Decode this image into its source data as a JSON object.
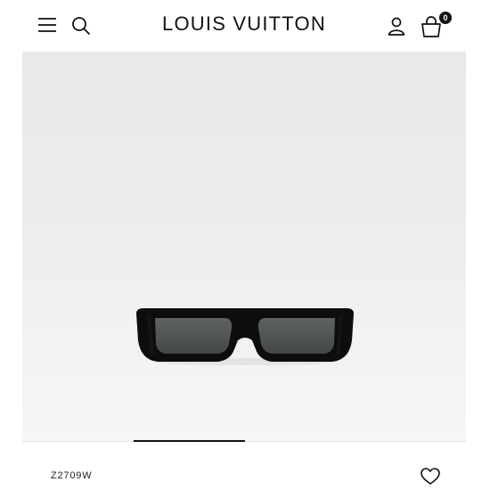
{
  "header": {
    "brand": "LOUIS VUITTON",
    "bag_count": "0",
    "icons": [
      "menu-icon",
      "search-icon",
      "account-icon",
      "shopping-bag-icon"
    ]
  },
  "product": {
    "reference": "Z2709W",
    "image": "black rectangular sunglasses with grey lenses",
    "wishlist_icon": "heart-icon"
  },
  "colors": {
    "text": "#111111",
    "hero_bg": "#ececec"
  }
}
